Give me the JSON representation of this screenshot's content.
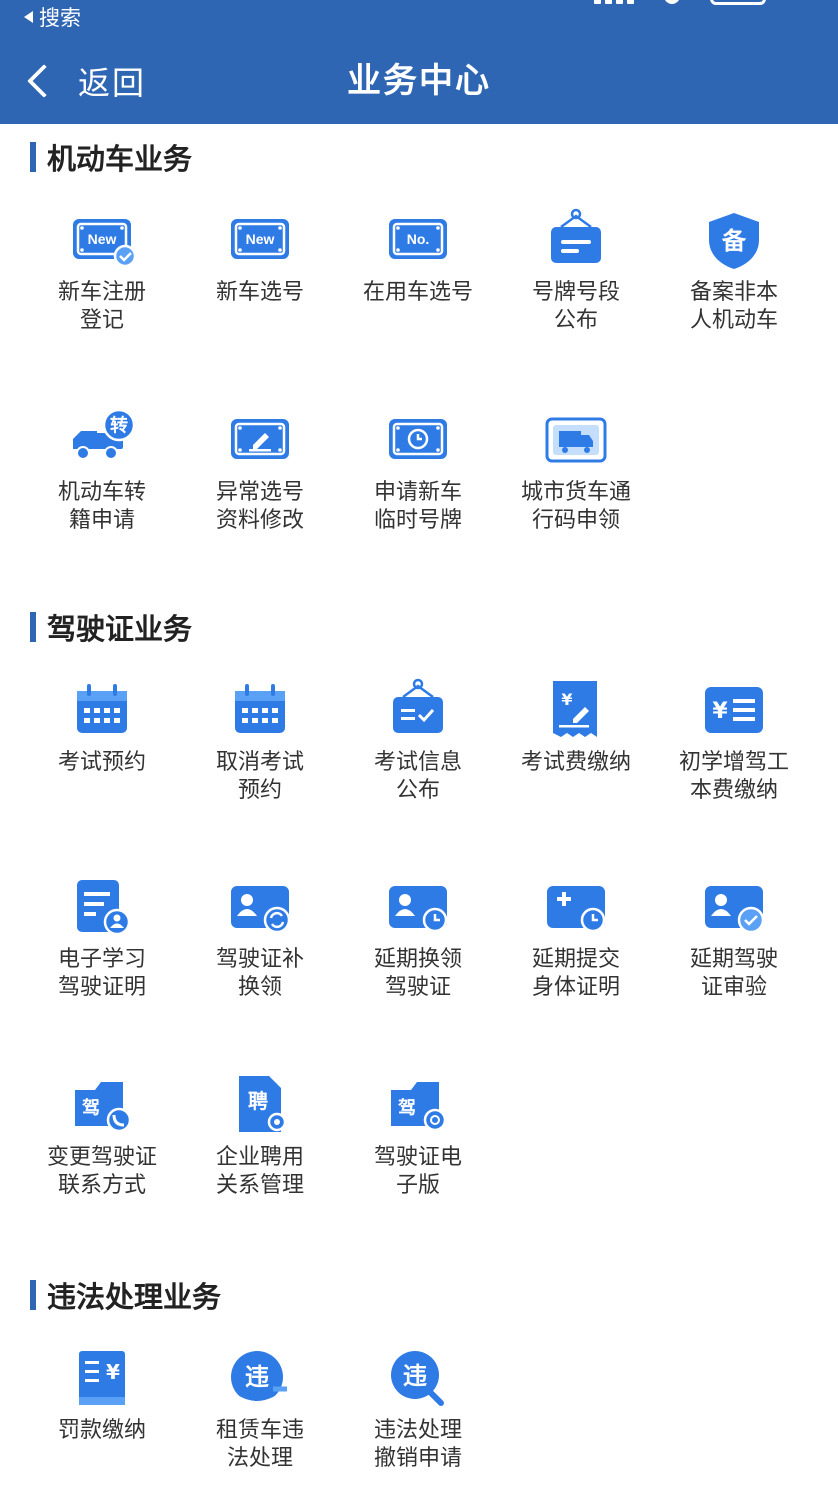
{
  "status_bar": {
    "back_app": "搜索"
  },
  "header": {
    "back_label": "返回",
    "title": "业务中心"
  },
  "colors": {
    "header_bg": "#2f66b3",
    "icon_blue": "#2f7be6",
    "icon_light": "#5aa0f5"
  },
  "sections": {
    "vehicle": {
      "title": "机动车业务",
      "items": [
        {
          "label": "新车注册\n登记",
          "icon": "new-registration-icon",
          "plate": "New"
        },
        {
          "label": "新车选号",
          "icon": "new-plate-selection-icon",
          "plate": "New"
        },
        {
          "label": "在用车选号",
          "icon": "used-car-plate-selection-icon",
          "plate": "No."
        },
        {
          "label": "号牌号段\n公布",
          "icon": "plate-range-announcement-icon"
        },
        {
          "label": "备案非本\n人机动车",
          "icon": "record-shield-icon",
          "badge": "备"
        },
        {
          "label": "机动车转\n籍申请",
          "icon": "vehicle-transfer-truck-icon",
          "badge": "转"
        },
        {
          "label": "异常选号\n资料修改",
          "icon": "edit-plate-icon"
        },
        {
          "label": "申请新车\n临时号牌",
          "icon": "temporary-plate-clock-icon"
        },
        {
          "label": "城市货车通\n行码申领",
          "icon": "truck-pass-icon"
        }
      ]
    },
    "license": {
      "title": "驾驶证业务",
      "items": [
        {
          "label": "考试预约",
          "icon": "calendar-icon"
        },
        {
          "label": "取消考试\n预约",
          "icon": "calendar-cancel-icon"
        },
        {
          "label": "考试信息\n公布",
          "icon": "exam-info-board-icon"
        },
        {
          "label": "考试费缴纳",
          "icon": "exam-fee-receipt-icon",
          "badge": "¥"
        },
        {
          "label": "初学增驾工\n本费缴纳",
          "icon": "fee-list-icon",
          "badge": "¥"
        },
        {
          "label": "电子学习\n驾驶证明",
          "icon": "study-certificate-icon"
        },
        {
          "label": "驾驶证补\n换领",
          "icon": "license-reissue-icon"
        },
        {
          "label": "延期换领\n驾驶证",
          "icon": "license-extend-renew-icon"
        },
        {
          "label": "延期提交\n身体证明",
          "icon": "medical-extend-icon"
        },
        {
          "label": "延期驾驶\n证审验",
          "icon": "license-extend-check-icon"
        },
        {
          "label": "变更驾驶证\n联系方式",
          "icon": "license-contact-change-icon",
          "badge": "驾"
        },
        {
          "label": "企业聘用\n关系管理",
          "icon": "employment-doc-icon",
          "badge": "聘"
        },
        {
          "label": "驾驶证电\n子版",
          "icon": "e-license-icon",
          "badge": "驾"
        }
      ]
    },
    "violation": {
      "title": "违法处理业务",
      "items": [
        {
          "label": "罚款缴纳",
          "icon": "fine-payment-icon",
          "badge": "¥"
        },
        {
          "label": "租赁车违\n法处理",
          "icon": "rental-violation-icon",
          "badge": "违"
        },
        {
          "label": "违法处理\n撤销申请",
          "icon": "violation-revoke-search-icon",
          "badge": "违"
        }
      ]
    }
  }
}
